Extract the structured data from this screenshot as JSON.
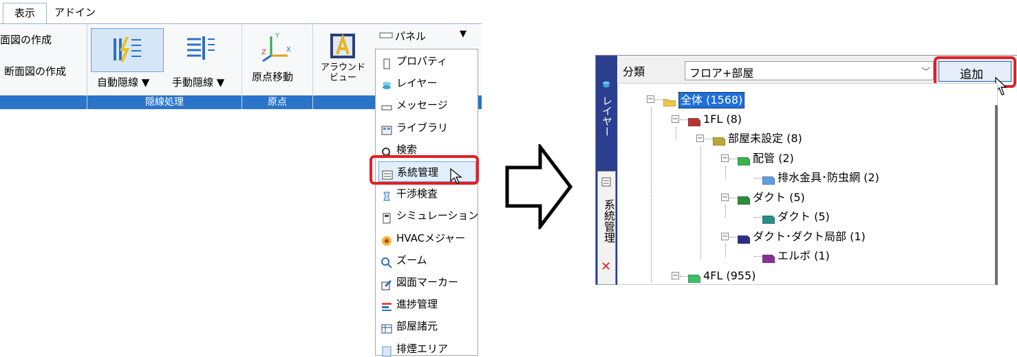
{
  "ribbon": {
    "tabs": [
      "表示",
      "アドイン"
    ],
    "create_elev_label": "面図の作成",
    "create_section_label": "断面図の作成",
    "auto_hidden_label": "自動隠線 ▼",
    "manual_hidden_label": "手動隠線 ▼",
    "origin_move_label": "原点移動",
    "around_view_label": "アラウンド\nビュー",
    "group_hidden": "隠線処理",
    "group_origin": "原点",
    "panel_label": "パネル",
    "panel_arrow": "▼"
  },
  "menu": {
    "items": [
      {
        "label": "プロパティ",
        "icon": "properties-icon"
      },
      {
        "label": "レイヤー",
        "icon": "layer-icon"
      },
      {
        "label": "メッセージ",
        "icon": "message-icon"
      },
      {
        "label": "ライブラリ",
        "icon": "library-icon"
      },
      {
        "label": "検索",
        "icon": "search-icon"
      },
      {
        "label": "系統管理",
        "icon": "system-manage-icon",
        "highlighted": true
      },
      {
        "label": "干渉検査",
        "icon": "interference-icon"
      },
      {
        "label": "シミュレーション",
        "icon": "simulation-icon"
      },
      {
        "label": "HVACメジャー",
        "icon": "hvac-icon"
      },
      {
        "label": "ズーム",
        "icon": "zoom-icon"
      },
      {
        "label": "図面マーカー",
        "icon": "marker-icon"
      },
      {
        "label": "進捗管理",
        "icon": "progress-icon"
      },
      {
        "label": "部屋諸元",
        "icon": "room-spec-icon"
      },
      {
        "label": "排煙エリア",
        "icon": "smoke-area-icon"
      }
    ]
  },
  "panel": {
    "vertical_tab_layer": "レイヤー",
    "vertical_tab_system": "系統管理",
    "category_label": "分類",
    "category_value": "フロア+部屋",
    "add_button": "追加",
    "tree": [
      {
        "label": "全体 (1568)",
        "level": 0,
        "color": "#f0c64a",
        "selected": true
      },
      {
        "label": "1FL (8)",
        "level": 1,
        "color": "#b83232"
      },
      {
        "label": "部屋未設定 (8)",
        "level": 2,
        "color": "#b9a83a"
      },
      {
        "label": "配管 (2)",
        "level": 3,
        "color": "#3bb34a"
      },
      {
        "label": "排水金具･防虫網 (2)",
        "level": 4,
        "color": "#5f9ee0"
      },
      {
        "label": "ダクト (5)",
        "level": 3,
        "color": "#2e8b3a"
      },
      {
        "label": "ダクト (5)",
        "level": 4,
        "color": "#2a8e86"
      },
      {
        "label": "ダクト･ダクト局部 (1)",
        "level": 3,
        "color": "#2b2f8c"
      },
      {
        "label": "エルボ (1)",
        "level": 4,
        "color": "#8c2d9a"
      },
      {
        "label": "4FL (955)",
        "level": 1,
        "color": "#3cbf6a"
      }
    ]
  }
}
